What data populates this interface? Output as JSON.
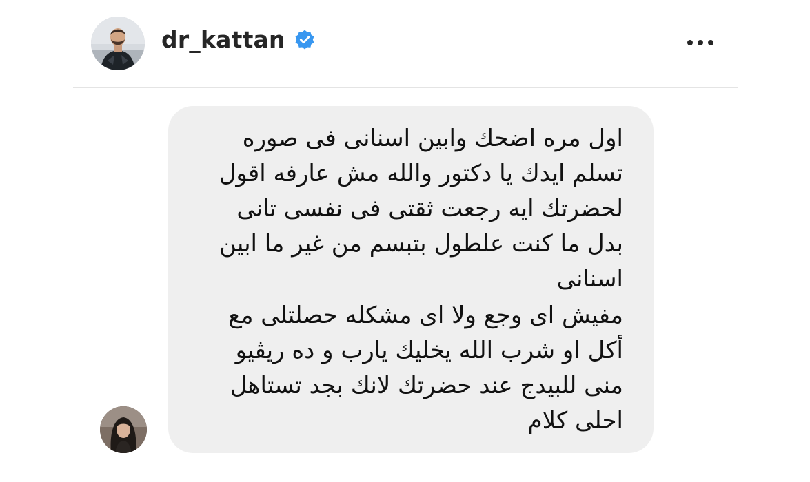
{
  "header": {
    "username": "dr_kattan",
    "verified_icon": "verified-badge-icon",
    "more_icon": "more-options-icon",
    "avatar": "profile-avatar"
  },
  "message": {
    "sender_avatar": "message-sender-avatar",
    "bubble_color": "#efefef",
    "lines": [
      "اول مره اضحك وابين اسنانى فى صوره",
      "تسلم ايدك يا دكتور والله مش عارفه اقول",
      "لحضرتك ايه رجعت ثقتى فى نفسى تانى",
      "بدل ما كنت علطول بتبسم من غير ما ابين",
      "اسنانى",
      "مفيش اى وجع ولا اى مشكله حصلتلى مع",
      "أكل او شرب الله يخليك يارب و ده ريڤيو",
      "منى للبيدج عند حضرتك لانك بجد تستاهل",
      "احلى كلام"
    ]
  },
  "colors": {
    "verified_blue": "#3897f0",
    "divider": "#e4e4e4",
    "text": "#262626"
  }
}
